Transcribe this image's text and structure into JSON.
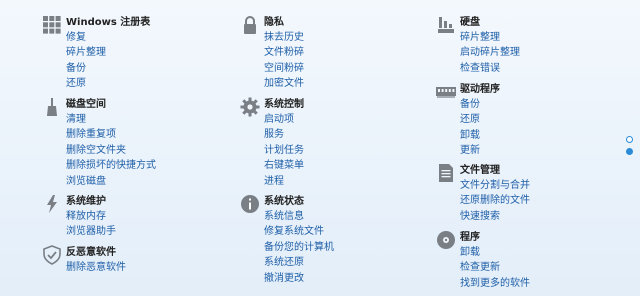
{
  "columns": [
    {
      "groups": [
        {
          "title": "Windows 注册表",
          "items": [
            "修复",
            "碎片整理",
            "备份",
            "还原"
          ]
        },
        {
          "title": "磁盘空间",
          "items": [
            "清理",
            "删除重复项",
            "删除空文件夹",
            "删除损坏的快捷方式",
            "浏览磁盘"
          ]
        },
        {
          "title": "系统维护",
          "items": [
            "释放内存",
            "浏览器助手"
          ]
        },
        {
          "title": "反恶意软件",
          "items": [
            "删除恶意软件"
          ]
        }
      ]
    },
    {
      "groups": [
        {
          "title": "隐私",
          "items": [
            "抹去历史",
            "文件粉碎",
            "空间粉碎",
            "加密文件"
          ]
        },
        {
          "title": "系统控制",
          "items": [
            "启动项",
            "服务",
            "计划任务",
            "右键菜单",
            "进程"
          ]
        },
        {
          "title": "系统状态",
          "items": [
            "系统信息",
            "修复系统文件",
            "备份您的计算机",
            "系统还原",
            "撤消更改"
          ]
        }
      ]
    },
    {
      "groups": [
        {
          "title": "硬盘",
          "items": [
            "碎片整理",
            "启动碎片整理",
            "检查错误"
          ]
        },
        {
          "title": "驱动程序",
          "items": [
            "备份",
            "还原",
            "卸载",
            "更新"
          ]
        },
        {
          "title": "文件管理",
          "items": [
            "文件分割与合并",
            "还原删除的文件",
            "快速搜索"
          ]
        },
        {
          "title": "程序",
          "items": [
            "卸载",
            "检查更新",
            "找到更多的软件"
          ]
        }
      ]
    }
  ],
  "icons": [
    [
      "grid-icon",
      "broom-icon",
      "lightning-icon",
      "shield-check-icon"
    ],
    [
      "lock-icon",
      "gear-icon",
      "info-icon"
    ],
    [
      "disk-chart-icon",
      "driver-board-icon",
      "document-icon",
      "cd-icon"
    ]
  ],
  "pager": {
    "active_page": 2,
    "total_pages": 2
  },
  "colors": {
    "link": "#1f5fa8",
    "title": "#222222",
    "icon": "#7a7f86",
    "accent": "#2a8bd6"
  }
}
